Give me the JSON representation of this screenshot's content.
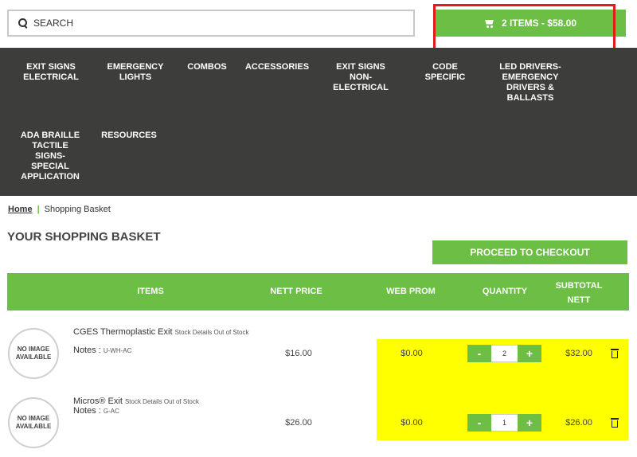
{
  "search": {
    "placeholder": "SEARCH"
  },
  "cart": {
    "label": "2 ITEMS - $58.00"
  },
  "nav": {
    "items": [
      "EXIT SIGNS\nELECTRICAL",
      "EMERGENCY\nLIGHTS",
      "COMBOS",
      "ACCESSORIES",
      "EXIT SIGNS\nNON-\nELECTRICAL",
      "CODE\nSPECIFIC",
      "LED DRIVERS-\nEMERGENCY\nDRIVERS &\nBALLASTS",
      "ADA BRAILLE\nTACTILE\nSIGNS-\nSPECIAL\nAPPLICATION",
      "RESOURCES"
    ]
  },
  "breadcrumb": {
    "home": "Home",
    "separator": "|",
    "current": "Shopping Basket"
  },
  "page": {
    "title": "YOUR SHOPPING BASKET",
    "checkout_label": "PROCEED TO CHECKOUT"
  },
  "table": {
    "headers": [
      "ITEMS",
      "NETT PRICE",
      "WEB PROM",
      "QUANTITY",
      "SUBTOTAL\nNETT"
    ],
    "no_image_text": "NO IMAGE\nAVAILABLE",
    "notes_label": "Notes :",
    "decrement_label": "-",
    "increment_label": "+",
    "rows": [
      {
        "name": "CGES Thermoplastic Exit",
        "stock": "Stock Details Out of Stock",
        "notes": "U-WH-AC",
        "nett_price": "$16.00",
        "web_prom": "$0.00",
        "quantity": "2",
        "subtotal": "$32.00"
      },
      {
        "name": "Micros® Exit",
        "stock": "Stock Details Out of Stock",
        "notes": "G-AC",
        "nett_price": "$26.00",
        "web_prom": "$0.00",
        "quantity": "1",
        "subtotal": "$26.00"
      }
    ]
  },
  "colors": {
    "accent": "#6cbe45",
    "nav_bg": "#3d3d3b",
    "promo_highlight": "#ffff00",
    "annotation": "#e21c1c"
  },
  "icons": [
    "search-icon",
    "cart-icon",
    "trash-icon"
  ]
}
